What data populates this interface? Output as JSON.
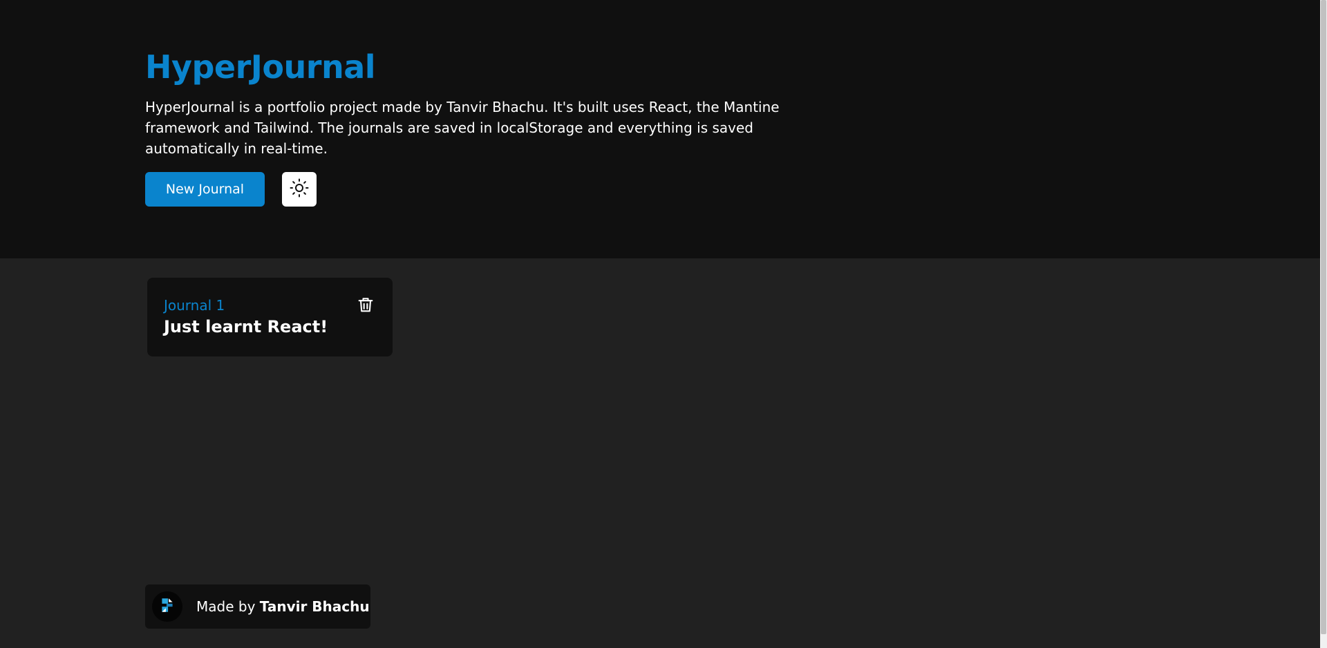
{
  "header": {
    "title": "HyperJournal",
    "description": "HyperJournal is a portfolio project made by Tanvir Bhachu. It's built uses React, the Mantine framework and Tailwind. The journals are saved in localStorage and everything is saved automatically in real-time.",
    "new_journal_label": "New Journal",
    "theme_toggle_icon": "sun-icon"
  },
  "journals": [
    {
      "label": "Journal 1",
      "title": "Just learnt React!",
      "delete_icon": "trash-icon"
    }
  ],
  "footer": {
    "prefix": "Made by",
    "author": "Tanvir Bhachu",
    "avatar_icon": "logo-icon"
  },
  "colors": {
    "accent": "#0a84cd",
    "hero_bg": "#101010",
    "page_bg": "#212121",
    "card_bg": "#101010"
  }
}
